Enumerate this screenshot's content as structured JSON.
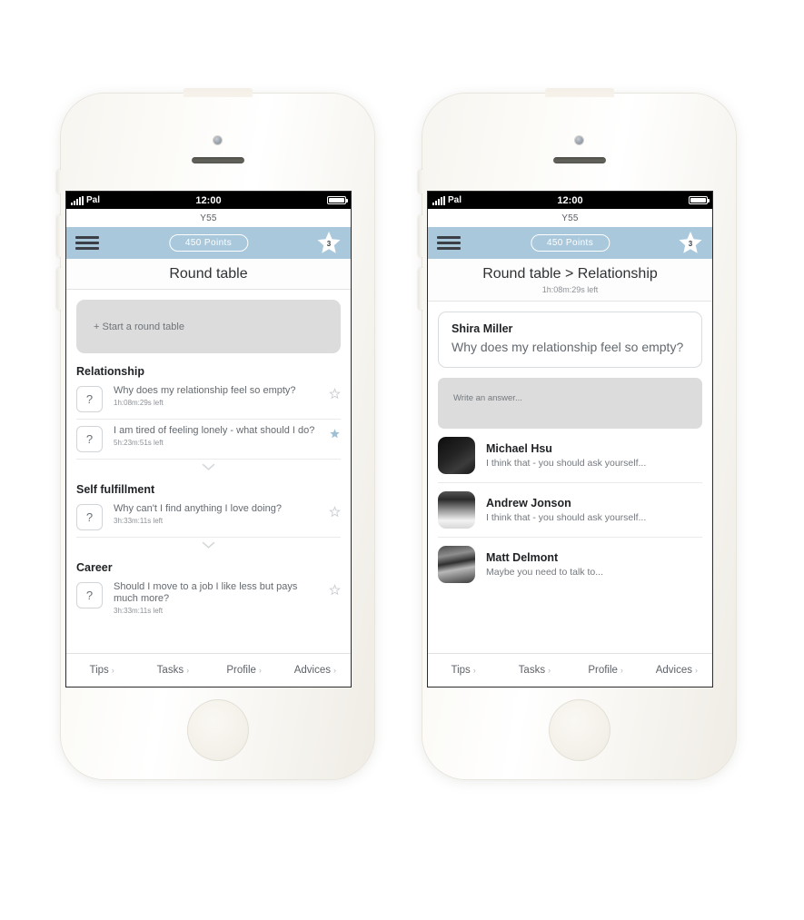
{
  "status_bar": {
    "carrier": "Pal",
    "time": "12:00",
    "signal_icon": "signal-bars-icon",
    "battery_icon": "battery-full-icon"
  },
  "brand": {
    "name": "Y55"
  },
  "nav": {
    "menu_icon": "hamburger-menu-icon",
    "points_label": "450 Points",
    "star_icon": "star-badge-icon",
    "star_count": "3"
  },
  "tab_bar": {
    "tabs": [
      {
        "label": "Tips",
        "chevron": "›"
      },
      {
        "label": "Tasks",
        "chevron": "›"
      },
      {
        "label": "Profile",
        "chevron": "›"
      },
      {
        "label": "Advices",
        "chevron": "›"
      }
    ]
  },
  "screen_list": {
    "title": "Round table",
    "start_block": {
      "label": "+ Start a round table"
    },
    "categories": [
      {
        "name": "Relationship",
        "questions": [
          {
            "icon": "question-mark-icon",
            "text": "Why does my relationship feel so empty?",
            "timer": "1h:08m:29s left",
            "favorite_icon": "star-outline-icon",
            "favorited": false
          },
          {
            "icon": "question-mark-icon",
            "text": "I am tired of feeling lonely - what should I do?",
            "timer": "5h:23m:51s left",
            "favorite_icon": "star-filled-icon",
            "favorited": true
          }
        ]
      },
      {
        "name": "Self fulfillment",
        "questions": [
          {
            "icon": "question-mark-icon",
            "text": "Why can't I find anything I love doing?",
            "timer": "3h:33m:11s left",
            "favorite_icon": "star-outline-icon",
            "favorited": false
          }
        ]
      },
      {
        "name": "Career",
        "questions": [
          {
            "icon": "question-mark-icon",
            "text": "Should I move to a job I like less but pays much more?",
            "timer": "3h:33m:11s left",
            "favorite_icon": "star-outline-icon",
            "favorited": false
          }
        ]
      }
    ],
    "collapse_icon": "chevron-down-icon"
  },
  "screen_detail": {
    "title": "Round table > Relationship",
    "timer": "1h:08m:29s left",
    "question_card": {
      "author": "Shira Miller",
      "question": "Why does my relationship feel so empty?"
    },
    "answer_input": {
      "placeholder": "Write an answer..."
    },
    "answers": [
      {
        "avatar": "avatar-image",
        "name": "Michael Hsu",
        "snippet": "I think that - you should ask yourself..."
      },
      {
        "avatar": "avatar-image",
        "name": "Andrew Jonson",
        "snippet": "I think that - you should ask yourself..."
      },
      {
        "avatar": "avatar-image",
        "name": "Matt Delmont",
        "snippet": "Maybe you need to talk to..."
      }
    ]
  },
  "colors": {
    "nav_blue": "#a9c8dc",
    "placeholder_gray": "#dcdcdc",
    "text_dark": "#1f2225",
    "text_muted": "#73787e",
    "device_white": "#f7f5f0"
  }
}
